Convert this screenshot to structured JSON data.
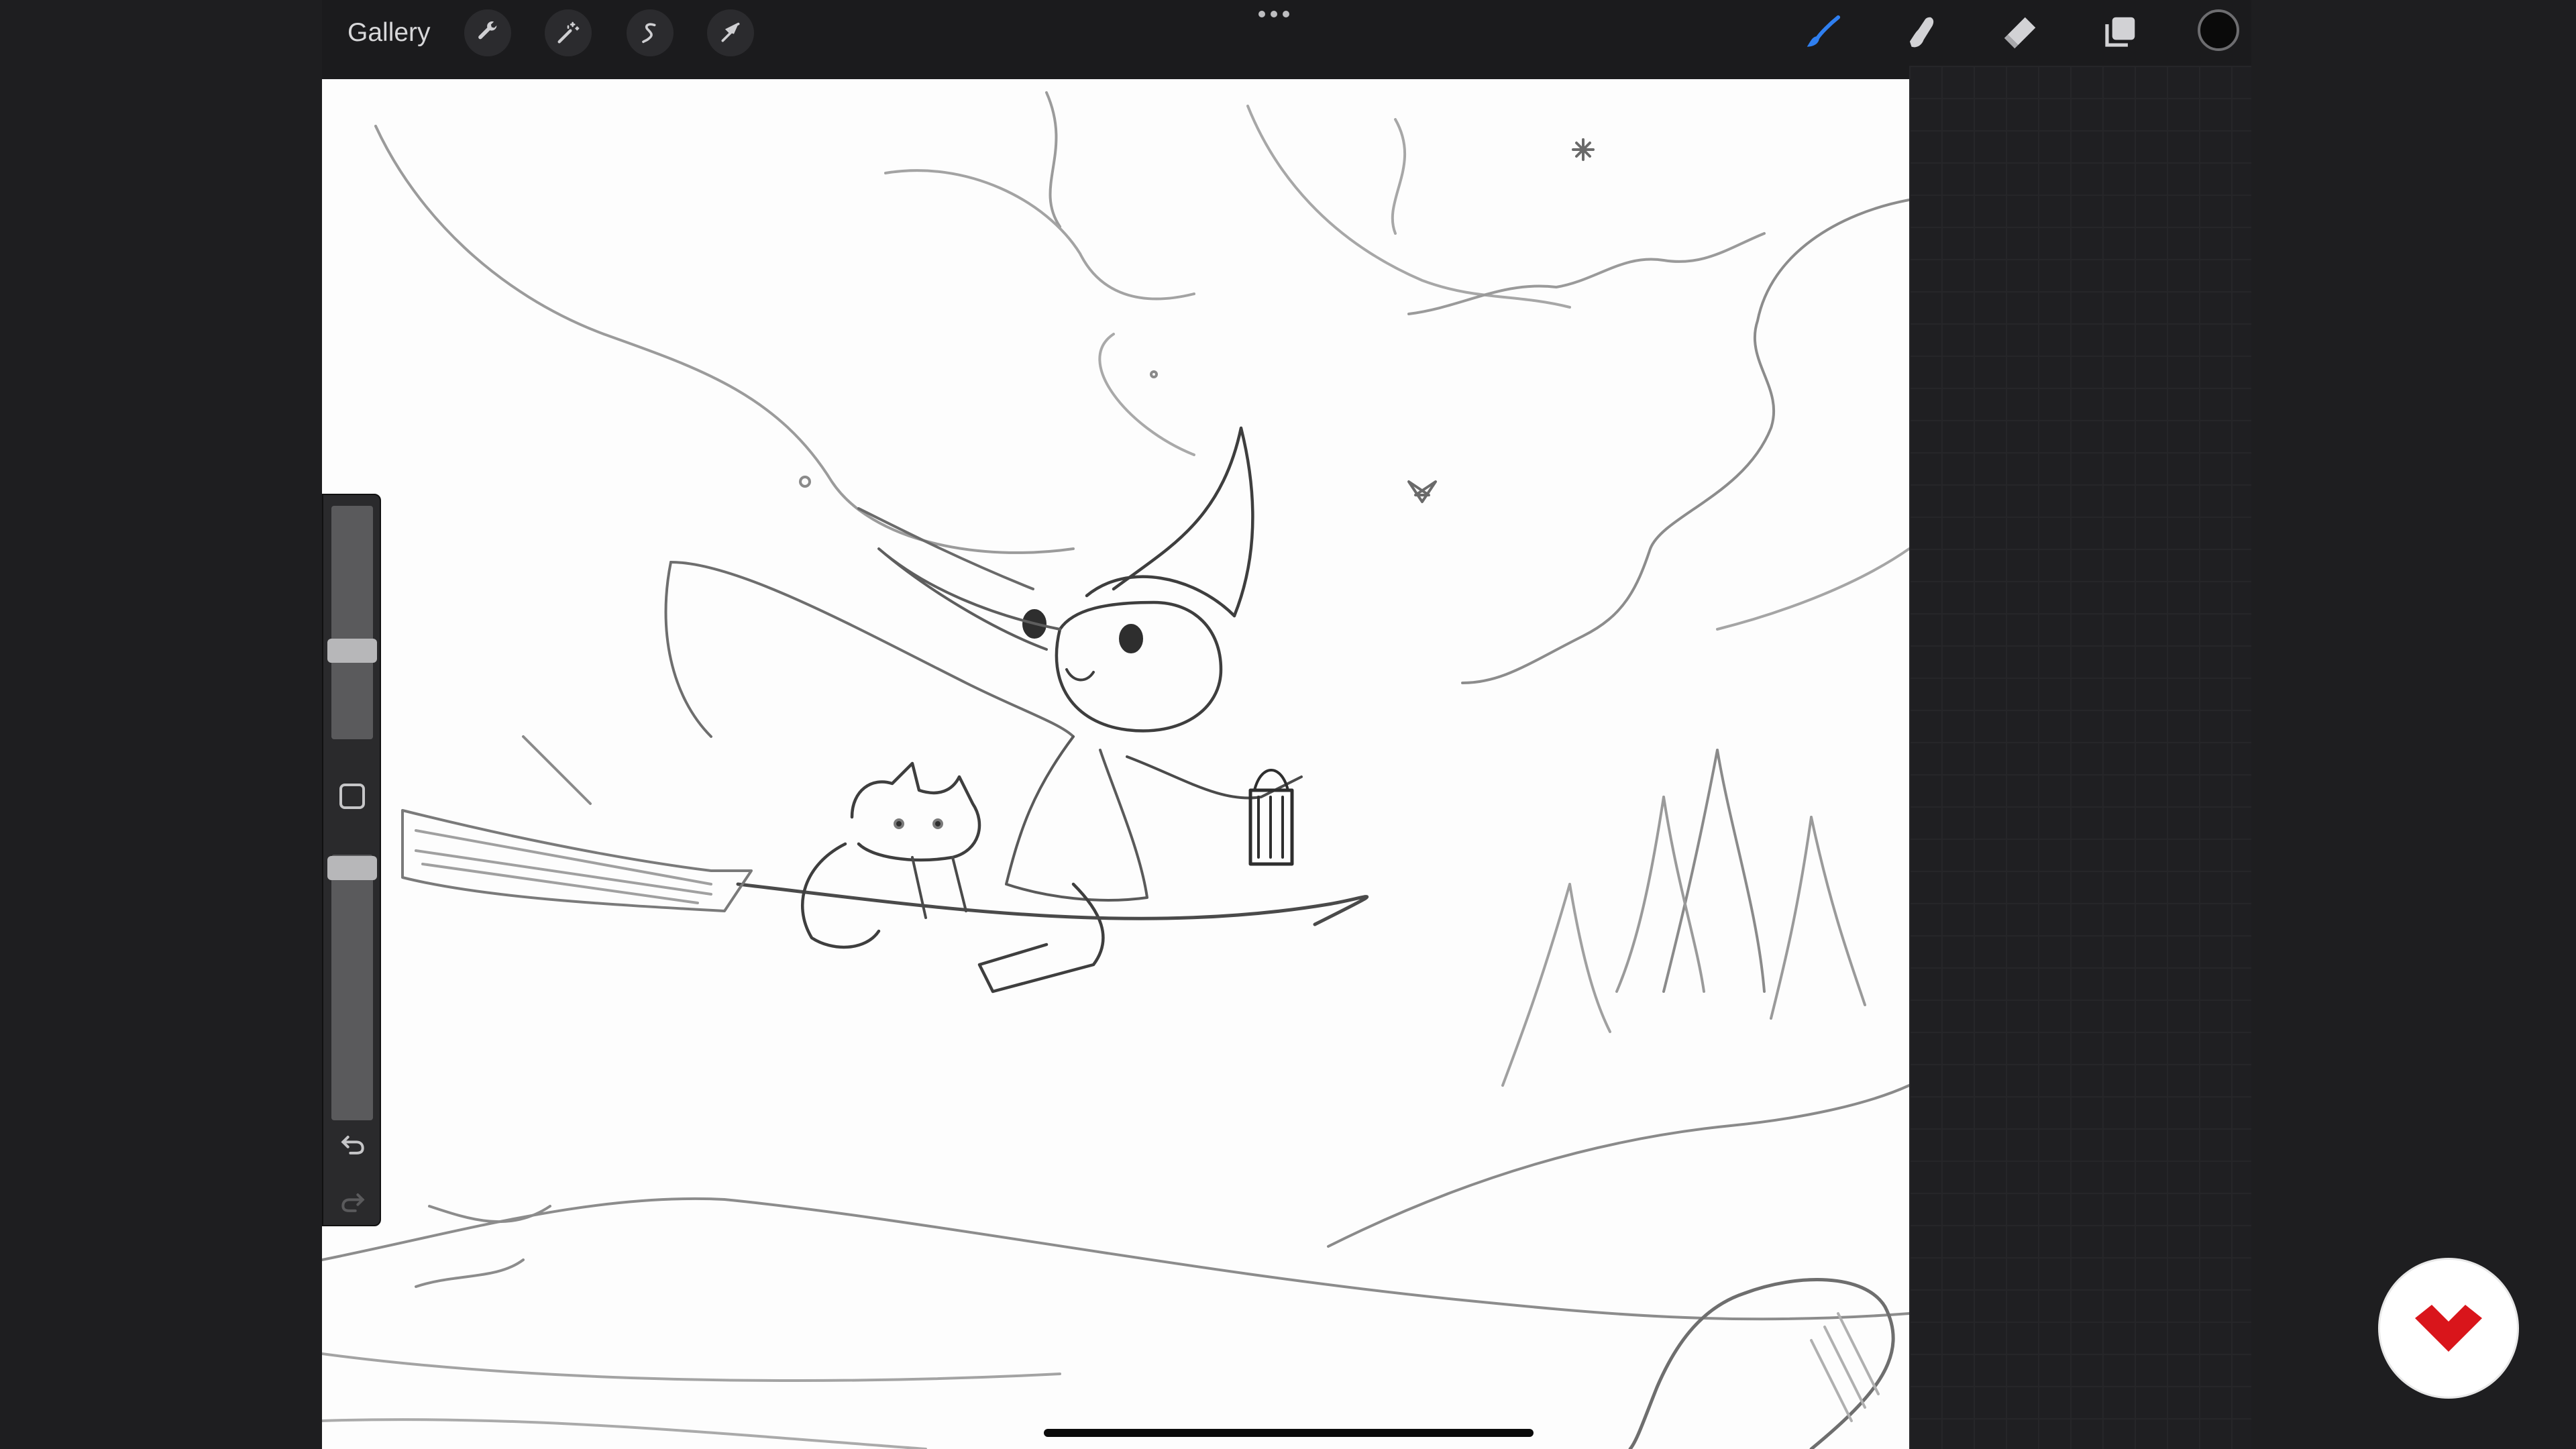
{
  "topbar": {
    "gallery_label": "Gallery",
    "left_tools": [
      {
        "name": "actions",
        "icon": "wrench-icon"
      },
      {
        "name": "adjustments",
        "icon": "magic-wand-icon"
      },
      {
        "name": "selection",
        "icon": "selection-s-icon"
      },
      {
        "name": "transform",
        "icon": "arrow-cursor-icon"
      }
    ],
    "more_icon": "ellipsis-icon",
    "right_tools": [
      {
        "name": "brush",
        "icon": "brush-icon",
        "active": true,
        "color": "#2f7ff0"
      },
      {
        "name": "smudge",
        "icon": "smudge-finger-icon",
        "active": false
      },
      {
        "name": "eraser",
        "icon": "eraser-icon",
        "active": false
      },
      {
        "name": "layers",
        "icon": "layers-icon",
        "active": false
      }
    ],
    "current_color": "#0a0a0a"
  },
  "sidebar": {
    "brush_size_level": 0.64,
    "opacity_level": 0.95,
    "modify_icon": "square-modify-icon",
    "undo_icon": "undo-icon",
    "redo_icon": "redo-icon"
  },
  "canvas": {
    "background": "#fdfdfd",
    "sketch_stroke": "#6e6e6e"
  },
  "brand_badge": {
    "icon": "brand-logo-icon",
    "color": "#d9151b"
  }
}
